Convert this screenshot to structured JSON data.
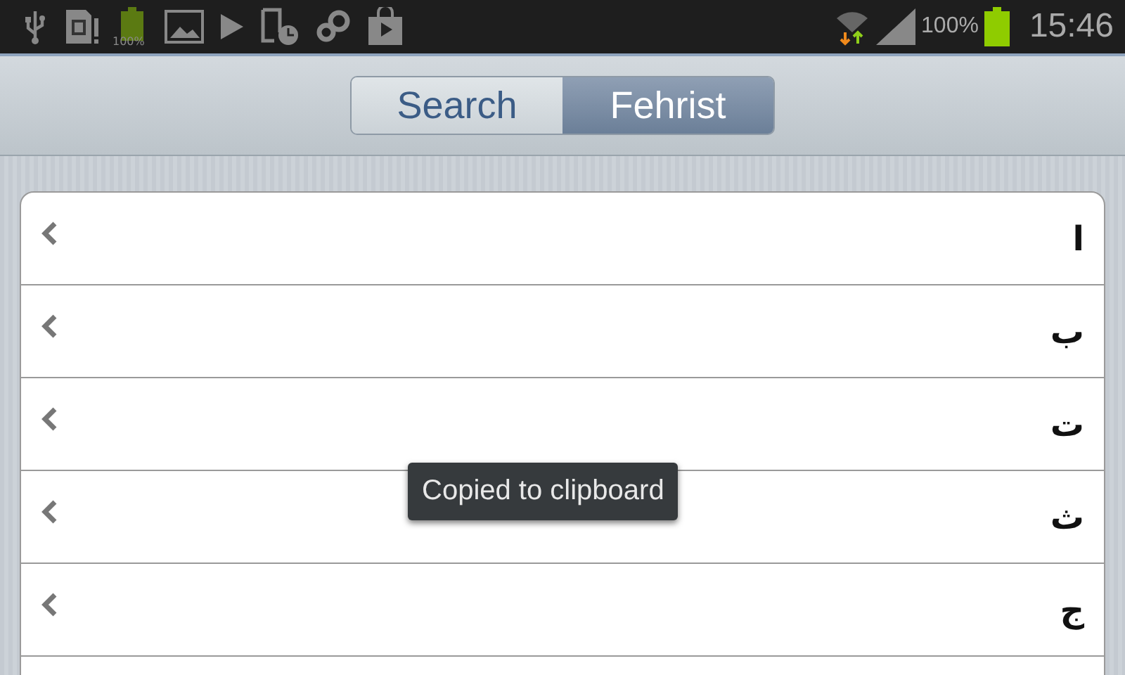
{
  "status_bar": {
    "battery_icon_label": "100%",
    "signal_text": "100%",
    "time": "15:46"
  },
  "tabs": [
    {
      "label": "Search",
      "selected": false
    },
    {
      "label": "Fehrist",
      "selected": true
    }
  ],
  "list": {
    "items": [
      {
        "label": "ا"
      },
      {
        "label": "ب"
      },
      {
        "label": "ت"
      },
      {
        "label": "ث"
      },
      {
        "label": "ج"
      }
    ]
  },
  "toast": "Copied to clipboard"
}
